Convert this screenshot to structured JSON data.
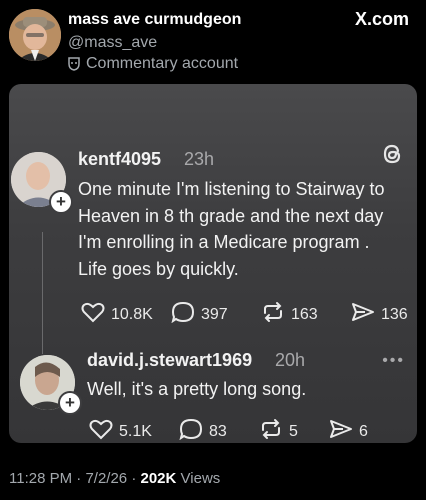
{
  "header": {
    "name": "mass ave curmudgeon",
    "handle": "@mass_ave",
    "label": "Commentary account",
    "brand": "X.com"
  },
  "card": {
    "post1": {
      "user": "kentf4095",
      "time": "23h",
      "text": "One minute I'm listening to Stairway to Heaven in 8 th grade and the next day I'm enrolling in a Medicare program . Life goes by quickly.",
      "likes": "10.8K",
      "replies": "397",
      "reposts": "163",
      "shares": "136"
    },
    "post2": {
      "user": "david.j.stewart1969",
      "time": "20h",
      "text": "Well, it's a pretty long song.",
      "likes": "5.1K",
      "replies": "83",
      "reposts": "5",
      "shares": "6"
    }
  },
  "footer": {
    "time": "11:28 PM",
    "date": "7/2/26",
    "views_count": "202K",
    "views_label": "Views"
  },
  "colors": {
    "background": "#000000",
    "card": "#3d3d3f",
    "muted": "#a3a8ad"
  }
}
